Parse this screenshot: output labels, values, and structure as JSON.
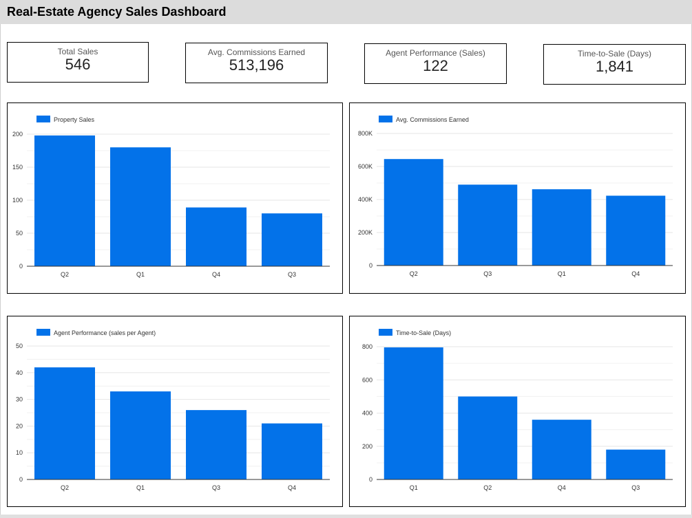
{
  "header": {
    "title": "Real-Estate Agency Sales Dashboard"
  },
  "colors": {
    "bar": "#0372e9",
    "grid": "#e6e6e6",
    "axis": "#333333",
    "header_bg": "#dcdcdc"
  },
  "kpis": [
    {
      "label": "Total Sales",
      "value": "546"
    },
    {
      "label": "Avg. Commissions Earned",
      "value": "513,196"
    },
    {
      "label": "Agent Performance (Sales)",
      "value": "122"
    },
    {
      "label": "Time-to-Sale (Days)",
      "value": "1,841"
    }
  ],
  "chart_data": [
    {
      "type": "bar",
      "legend": "Property Sales",
      "categories": [
        "Q2",
        "Q1",
        "Q4",
        "Q3"
      ],
      "values": [
        198,
        180,
        89,
        80
      ],
      "ylim": [
        0,
        200
      ],
      "yticks": [
        0,
        50,
        100,
        150,
        200
      ],
      "ytick_labels": [
        "0",
        "50",
        "100",
        "150",
        "200"
      ],
      "grid": true,
      "legend_position": "top-left"
    },
    {
      "type": "bar",
      "legend": "Avg. Commissions Earned",
      "categories": [
        "Q2",
        "Q3",
        "Q1",
        "Q4"
      ],
      "values": [
        645000,
        490000,
        462000,
        423000
      ],
      "ylim": [
        0,
        800000
      ],
      "yticks": [
        0,
        200000,
        400000,
        600000,
        800000
      ],
      "ytick_labels": [
        "0",
        "200K",
        "400K",
        "600K",
        "800K"
      ],
      "grid": true,
      "legend_position": "top-left"
    },
    {
      "type": "bar",
      "legend": "Agent Performance (sales per Agent)",
      "categories": [
        "Q2",
        "Q1",
        "Q3",
        "Q4"
      ],
      "values": [
        42,
        33,
        26,
        21
      ],
      "ylim": [
        0,
        50
      ],
      "yticks": [
        0,
        10,
        20,
        30,
        40,
        50
      ],
      "ytick_labels": [
        "0",
        "10",
        "20",
        "30",
        "40",
        "50"
      ],
      "grid": true,
      "legend_position": "top-left"
    },
    {
      "type": "bar",
      "legend": "Time-to-Sale (Days)",
      "categories": [
        "Q1",
        "Q2",
        "Q4",
        "Q3"
      ],
      "values": [
        796,
        500,
        360,
        180
      ],
      "ylim": [
        0,
        800
      ],
      "yticks": [
        0,
        200,
        400,
        600,
        800
      ],
      "ytick_labels": [
        "0",
        "200",
        "400",
        "600",
        "800"
      ],
      "grid": true,
      "legend_position": "top-left"
    }
  ]
}
